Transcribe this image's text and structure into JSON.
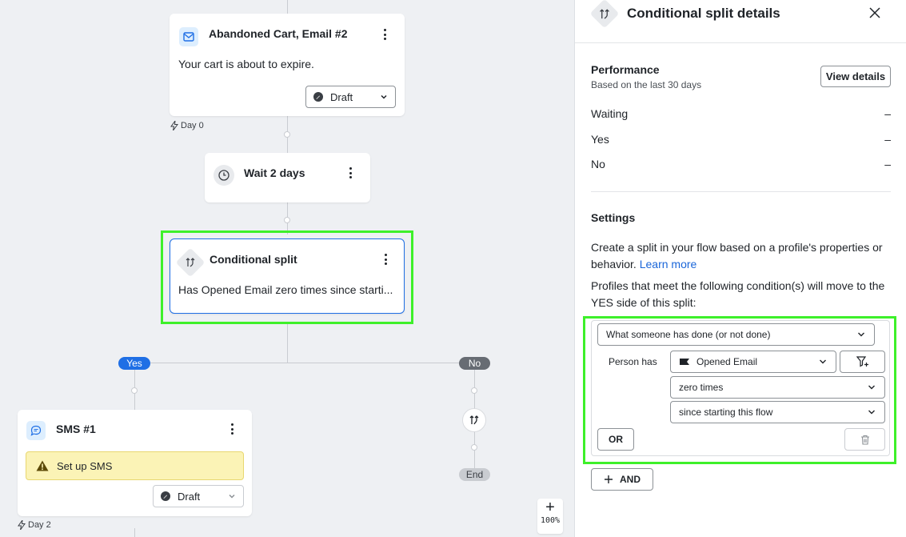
{
  "canvas": {
    "email_card": {
      "title": "Abandoned Cart, Email #2",
      "text": "Your cart is about to expire.",
      "status": "Draft",
      "day": "Day 0"
    },
    "wait_card": {
      "title": "Wait 2 days"
    },
    "split_card": {
      "title": "Conditional split",
      "text": "Has Opened Email zero times since starti..."
    },
    "yes_label": "Yes",
    "no_label": "No",
    "end_label": "End",
    "sms_card": {
      "title": "SMS #1",
      "warning": "Set up SMS",
      "status": "Draft",
      "day": "Day 2"
    },
    "zoom": {
      "plus": "+",
      "level": "100%"
    }
  },
  "panel": {
    "title": "Conditional split details",
    "performance": {
      "title": "Performance",
      "subtitle": "Based on the last 30 days",
      "view_details": "View details",
      "rows": [
        {
          "label": "Waiting",
          "value": "–"
        },
        {
          "label": "Yes",
          "value": "–"
        },
        {
          "label": "No",
          "value": "–"
        }
      ]
    },
    "settings": {
      "title": "Settings",
      "desc": "Create a split in your flow based on a profile's properties or behavior.",
      "learn_more": "Learn more",
      "desc2": "Profiles that meet the following condition(s) will move to the YES side of this split:",
      "condition_type": "What someone has done (or not done)",
      "person_has": "Person has",
      "metric": "Opened Email",
      "frequency": "zero times",
      "timeframe": "since starting this flow",
      "or_label": "OR",
      "and_label": "AND"
    }
  },
  "colors": {
    "accent": "#1f6fe5",
    "highlight": "#3ef02a",
    "canvas_bg": "#eef0f3",
    "warning_bg": "#fbf3b6"
  }
}
